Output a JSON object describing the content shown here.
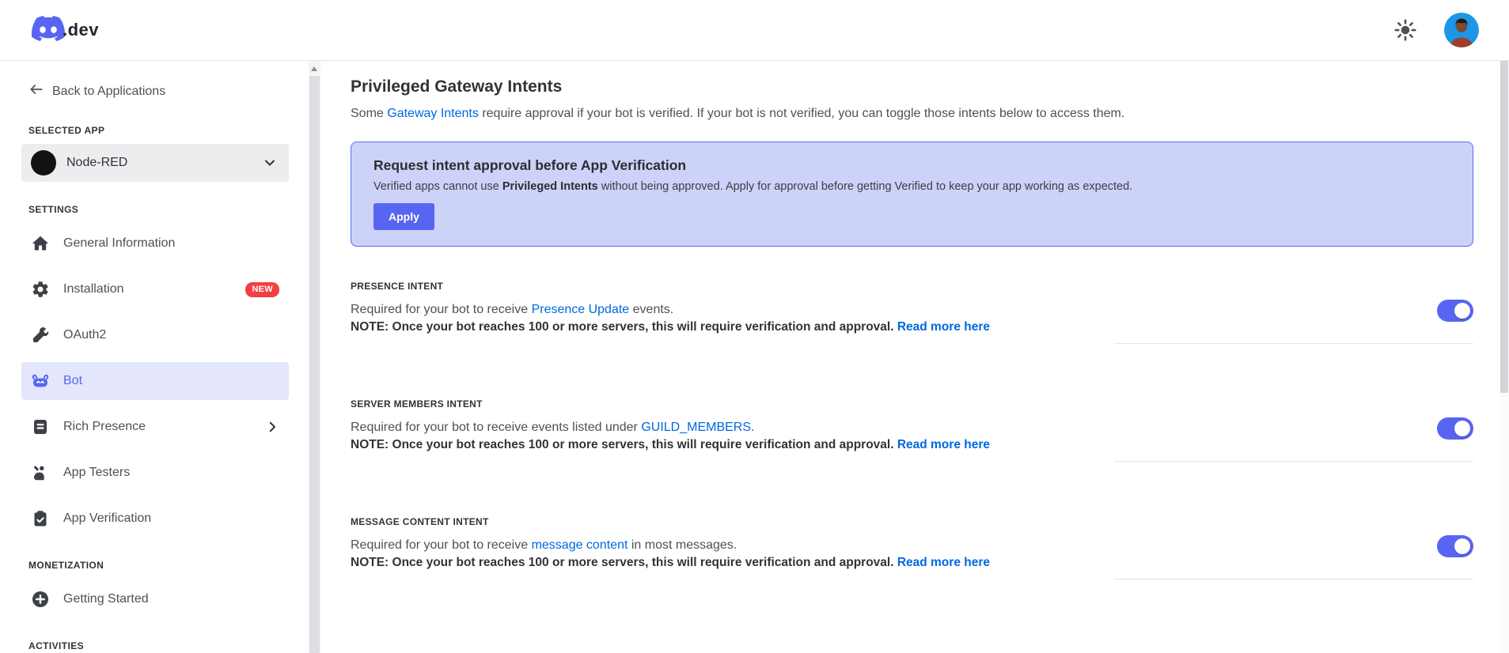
{
  "header": {
    "wordmark_suffix": ".dev"
  },
  "sidebar": {
    "back_label": "Back to Applications",
    "selected_app": {
      "heading": "SELECTED APP",
      "app_name": "Node-RED"
    },
    "settings": {
      "heading": "SETTINGS",
      "items": [
        {
          "label": "General Information",
          "icon": "home-icon",
          "active": false
        },
        {
          "label": "Installation",
          "icon": "gear-icon",
          "badge": "NEW",
          "active": false
        },
        {
          "label": "OAuth2",
          "icon": "wrench-icon",
          "active": false
        },
        {
          "label": "Bot",
          "icon": "bot-icon",
          "active": true
        },
        {
          "label": "Rich Presence",
          "icon": "journal-icon",
          "has_submenu": true,
          "active": false
        },
        {
          "label": "App Testers",
          "icon": "person-raised-hand-icon",
          "active": false
        },
        {
          "label": "App Verification",
          "icon": "clipboard-check-icon",
          "active": false
        }
      ]
    },
    "monetization": {
      "heading": "MONETIZATION",
      "items": [
        {
          "label": "Getting Started",
          "icon": "plus-circle-icon",
          "active": false
        }
      ]
    },
    "activities": {
      "heading": "ACTIVITIES"
    }
  },
  "main": {
    "title": "Privileged Gateway Intents",
    "intro": {
      "pre": "Some ",
      "link_text": "Gateway Intents",
      "post": " require approval if your bot is verified. If your bot is not verified, you can toggle those intents below to access them."
    },
    "banner": {
      "title": "Request intent approval before App Verification",
      "body_pre": "Verified apps cannot use ",
      "body_bold": "Privileged Intents",
      "body_post": " without being approved. Apply for approval before getting Verified to keep your app working as expected.",
      "button_label": "Apply"
    },
    "intents": [
      {
        "label": "PRESENCE INTENT",
        "desc_pre": "Required for your bot to receive ",
        "desc_link": "Presence Update",
        "desc_post": " events.",
        "note": "NOTE: Once your bot reaches 100 or more servers, this will require verification and approval. ",
        "note_link": "Read more here",
        "enabled": true
      },
      {
        "label": "SERVER MEMBERS INTENT",
        "desc_pre": "Required for your bot to receive events listed under ",
        "desc_link": "GUILD_MEMBERS",
        "desc_post": ".",
        "note": "NOTE: Once your bot reaches 100 or more servers, this will require verification and approval. ",
        "note_link": "Read more here",
        "enabled": true
      },
      {
        "label": "MESSAGE CONTENT INTENT",
        "desc_pre": "Required for your bot to receive ",
        "desc_link": "message content",
        "desc_post": " in most messages.",
        "note": "NOTE: Once your bot reaches 100 or more servers, this will require verification and approval. ",
        "note_link": "Read more here",
        "enabled": true
      }
    ]
  },
  "colors": {
    "blurple": "#5865f2",
    "link_blue": "#0068e0",
    "banner_bg": "#cdd2f8",
    "banner_border": "#5c6af2",
    "badge_red": "#f23f43",
    "active_item_bg": "#e4e6fc"
  }
}
